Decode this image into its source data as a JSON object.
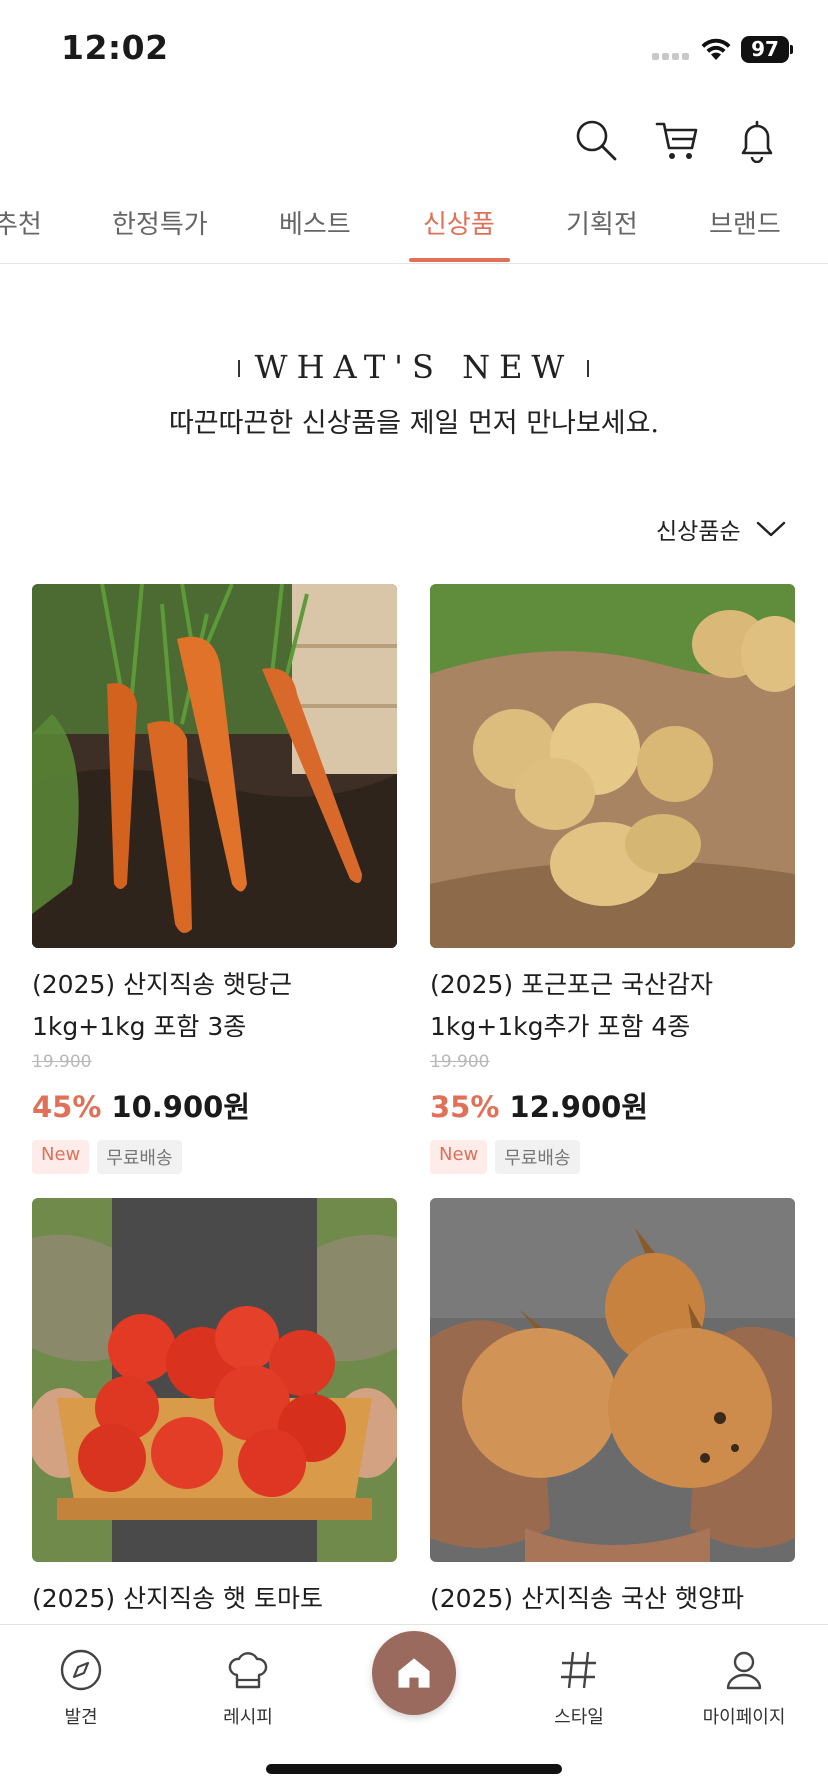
{
  "status_bar": {
    "time": "12:02",
    "battery": "97"
  },
  "tabs": [
    {
      "label": "추천",
      "active": false
    },
    {
      "label": "한정특가",
      "active": false
    },
    {
      "label": "베스트",
      "active": false
    },
    {
      "label": "신상품",
      "active": true
    },
    {
      "label": "기획전",
      "active": false
    },
    {
      "label": "브랜드",
      "active": false
    }
  ],
  "hero": {
    "title": "WHAT'S NEW",
    "subtitle": "따끈따끈한 신상품을 제일 먼저 만나보세요."
  },
  "sort": {
    "selected": "신상품순"
  },
  "products": [
    {
      "name_line1": "(2025) 산지직송 햇당근",
      "name_line2": "1kg+1kg 포함 3종",
      "original_price": "19.900",
      "discount": "45%",
      "price": "10.900원",
      "tag_new": "New",
      "tag_shipping": "무료배송",
      "image": "carrots"
    },
    {
      "name_line1": "(2025) 포근포근 국산감자",
      "name_line2": "1kg+1kg추가 포함 4종",
      "original_price": "19.900",
      "discount": "35%",
      "price": "12.900원",
      "tag_new": "New",
      "tag_shipping": "무료배송",
      "image": "potatoes"
    },
    {
      "name_line1": "(2025) 산지직송 햇 토마토",
      "image": "tomatoes"
    },
    {
      "name_line1": "(2025) 산지직송 국산 햇양파",
      "image": "onions"
    }
  ],
  "bottom_nav": [
    {
      "label": "발견",
      "icon": "compass-icon"
    },
    {
      "label": "레시피",
      "icon": "chef-hat-icon"
    },
    {
      "label": "",
      "icon": "home-icon"
    },
    {
      "label": "스타일",
      "icon": "hashtag-icon"
    },
    {
      "label": "마이페이지",
      "icon": "user-icon"
    }
  ],
  "colors": {
    "accent": "#e07057",
    "home_button": "#9a6a5e"
  }
}
